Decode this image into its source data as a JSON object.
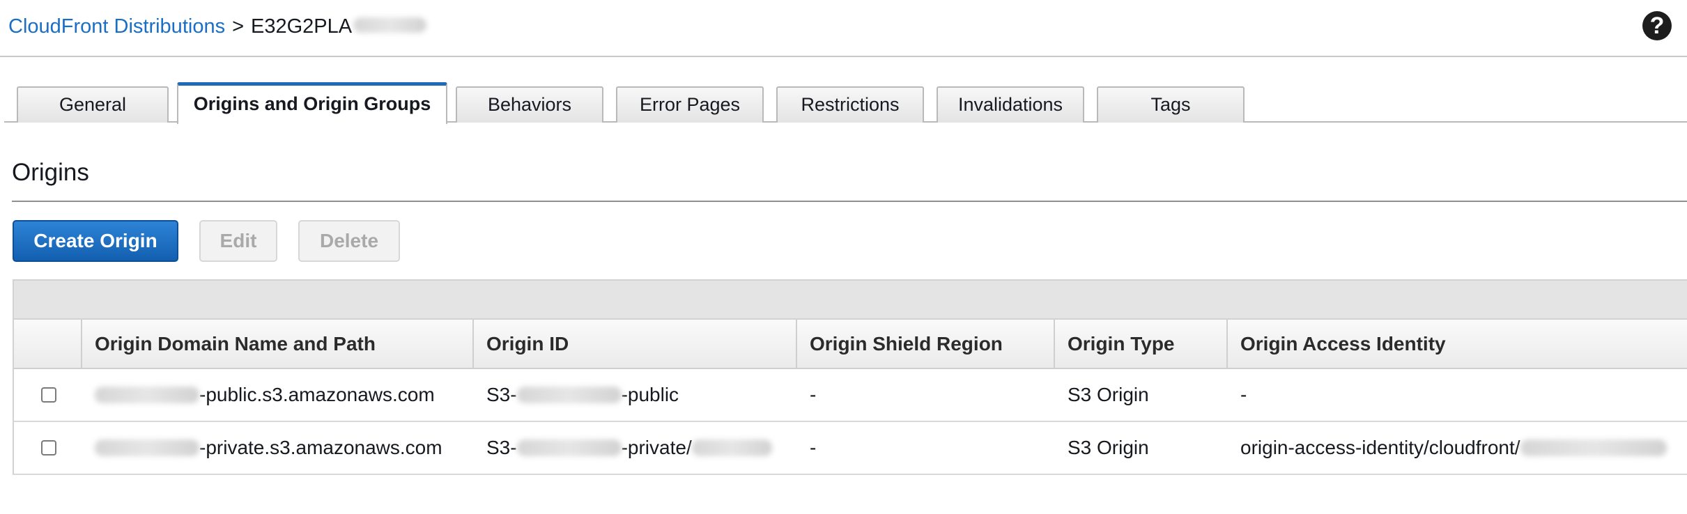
{
  "breadcrumb": {
    "parent": "CloudFront Distributions",
    "separator": ">",
    "current": "E32G2PLA"
  },
  "help": {
    "glyph": "?"
  },
  "tabs": [
    {
      "label": "General",
      "active": false
    },
    {
      "label": "Origins and Origin Groups",
      "active": true
    },
    {
      "label": "Behaviors",
      "active": false
    },
    {
      "label": "Error Pages",
      "active": false
    },
    {
      "label": "Restrictions",
      "active": false
    },
    {
      "label": "Invalidations",
      "active": false
    },
    {
      "label": "Tags",
      "active": false
    }
  ],
  "origins": {
    "title": "Origins",
    "buttons": {
      "create": "Create Origin",
      "edit": "Edit",
      "delete": "Delete"
    },
    "columns": [
      "Origin Domain Name and Path",
      "Origin ID",
      "Origin Shield Region",
      "Origin Type",
      "Origin Access Identity"
    ],
    "rows": [
      {
        "domain_suffix": "-public.s3.amazonaws.com",
        "id_prefix": "S3-",
        "id_suffix": "-public",
        "shield_region": "-",
        "type": "S3 Origin",
        "access_identity": "-"
      },
      {
        "domain_suffix": "-private.s3.amazonaws.com",
        "id_prefix": "S3-",
        "id_suffix": "-private/",
        "shield_region": "-",
        "type": "S3 Origin",
        "access_identity": "origin-access-identity/cloudfront/"
      }
    ]
  },
  "colors": {
    "link": "#1a6fc4",
    "primary_button": "#1f6bb9",
    "active_tab_accent": "#1f6bb9"
  }
}
